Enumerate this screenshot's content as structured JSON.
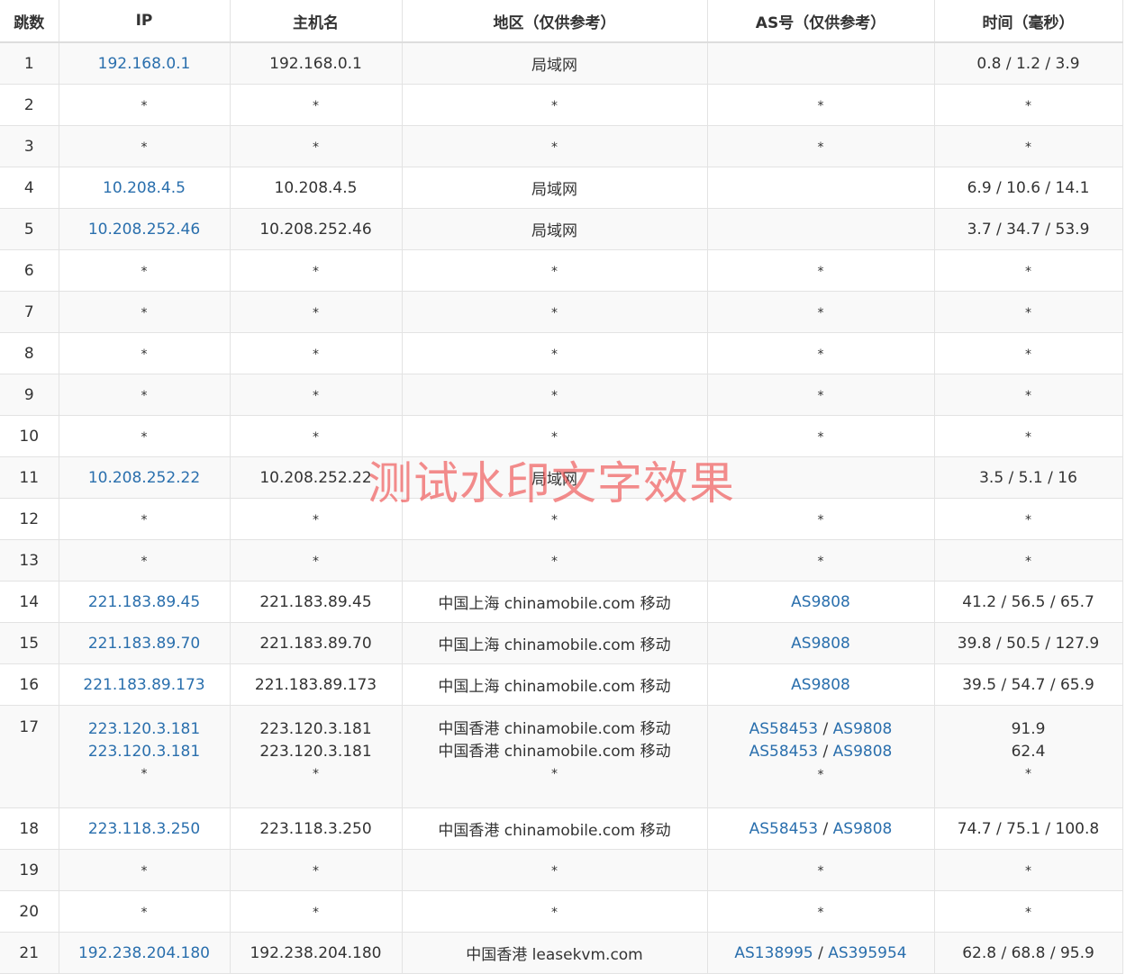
{
  "headers": [
    "跳数",
    "IP",
    "主机名",
    "地区（仅供参考）",
    "AS号（仅供参考）",
    "时间（毫秒）"
  ],
  "watermark": "测试水印文字效果",
  "rows": [
    {
      "hop": "1",
      "ip": [
        "192.168.0.1"
      ],
      "host": [
        "192.168.0.1"
      ],
      "region": [
        "局域网"
      ],
      "as": [
        []
      ],
      "time": [
        "0.8 / 1.2 / 3.9"
      ]
    },
    {
      "hop": "2",
      "ip": [
        "*"
      ],
      "host": [
        "*"
      ],
      "region": [
        "*"
      ],
      "as": [
        [
          "*"
        ]
      ],
      "time": [
        "*"
      ]
    },
    {
      "hop": "3",
      "ip": [
        "*"
      ],
      "host": [
        "*"
      ],
      "region": [
        "*"
      ],
      "as": [
        [
          "*"
        ]
      ],
      "time": [
        "*"
      ]
    },
    {
      "hop": "4",
      "ip": [
        "10.208.4.5"
      ],
      "host": [
        "10.208.4.5"
      ],
      "region": [
        "局域网"
      ],
      "as": [
        []
      ],
      "time": [
        "6.9 / 10.6 / 14.1"
      ]
    },
    {
      "hop": "5",
      "ip": [
        "10.208.252.46"
      ],
      "host": [
        "10.208.252.46"
      ],
      "region": [
        "局域网"
      ],
      "as": [
        []
      ],
      "time": [
        "3.7 / 34.7 / 53.9"
      ]
    },
    {
      "hop": "6",
      "ip": [
        "*"
      ],
      "host": [
        "*"
      ],
      "region": [
        "*"
      ],
      "as": [
        [
          "*"
        ]
      ],
      "time": [
        "*"
      ]
    },
    {
      "hop": "7",
      "ip": [
        "*"
      ],
      "host": [
        "*"
      ],
      "region": [
        "*"
      ],
      "as": [
        [
          "*"
        ]
      ],
      "time": [
        "*"
      ]
    },
    {
      "hop": "8",
      "ip": [
        "*"
      ],
      "host": [
        "*"
      ],
      "region": [
        "*"
      ],
      "as": [
        [
          "*"
        ]
      ],
      "time": [
        "*"
      ]
    },
    {
      "hop": "9",
      "ip": [
        "*"
      ],
      "host": [
        "*"
      ],
      "region": [
        "*"
      ],
      "as": [
        [
          "*"
        ]
      ],
      "time": [
        "*"
      ]
    },
    {
      "hop": "10",
      "ip": [
        "*"
      ],
      "host": [
        "*"
      ],
      "region": [
        "*"
      ],
      "as": [
        [
          "*"
        ]
      ],
      "time": [
        "*"
      ]
    },
    {
      "hop": "11",
      "ip": [
        "10.208.252.22"
      ],
      "host": [
        "10.208.252.22"
      ],
      "region": [
        "局域网"
      ],
      "as": [
        []
      ],
      "time": [
        "3.5 / 5.1 / 16"
      ]
    },
    {
      "hop": "12",
      "ip": [
        "*"
      ],
      "host": [
        "*"
      ],
      "region": [
        "*"
      ],
      "as": [
        [
          "*"
        ]
      ],
      "time": [
        "*"
      ]
    },
    {
      "hop": "13",
      "ip": [
        "*"
      ],
      "host": [
        "*"
      ],
      "region": [
        "*"
      ],
      "as": [
        [
          "*"
        ]
      ],
      "time": [
        "*"
      ]
    },
    {
      "hop": "14",
      "ip": [
        "221.183.89.45"
      ],
      "host": [
        "221.183.89.45"
      ],
      "region": [
        "中国上海 chinamobile.com 移动"
      ],
      "as": [
        [
          "AS9808"
        ]
      ],
      "time": [
        "41.2 / 56.5 / 65.7"
      ]
    },
    {
      "hop": "15",
      "ip": [
        "221.183.89.70"
      ],
      "host": [
        "221.183.89.70"
      ],
      "region": [
        "中国上海 chinamobile.com 移动"
      ],
      "as": [
        [
          "AS9808"
        ]
      ],
      "time": [
        "39.8 / 50.5 / 127.9"
      ]
    },
    {
      "hop": "16",
      "ip": [
        "221.183.89.173"
      ],
      "host": [
        "221.183.89.173"
      ],
      "region": [
        "中国上海 chinamobile.com 移动"
      ],
      "as": [
        [
          "AS9808"
        ]
      ],
      "time": [
        "39.5 / 54.7 / 65.9"
      ]
    },
    {
      "hop": "17",
      "ip": [
        "223.120.3.181",
        "223.120.3.181",
        "*"
      ],
      "host": [
        "223.120.3.181",
        "223.120.3.181",
        "*"
      ],
      "region": [
        "中国香港 chinamobile.com 移动",
        "中国香港 chinamobile.com 移动",
        "*"
      ],
      "as": [
        [
          "AS58453",
          "AS9808"
        ],
        [
          "AS58453",
          "AS9808"
        ],
        [
          "*"
        ]
      ],
      "time": [
        "91.9",
        "62.4",
        "*"
      ]
    },
    {
      "hop": "18",
      "ip": [
        "223.118.3.250"
      ],
      "host": [
        "223.118.3.250"
      ],
      "region": [
        "中国香港 chinamobile.com 移动"
      ],
      "as": [
        [
          "AS58453",
          "AS9808"
        ]
      ],
      "time": [
        "74.7 / 75.1 / 100.8"
      ]
    },
    {
      "hop": "19",
      "ip": [
        "*"
      ],
      "host": [
        "*"
      ],
      "region": [
        "*"
      ],
      "as": [
        [
          "*"
        ]
      ],
      "time": [
        "*"
      ]
    },
    {
      "hop": "20",
      "ip": [
        "*"
      ],
      "host": [
        "*"
      ],
      "region": [
        "*"
      ],
      "as": [
        [
          "*"
        ]
      ],
      "time": [
        "*"
      ]
    },
    {
      "hop": "21",
      "ip": [
        "192.238.204.180"
      ],
      "host": [
        "192.238.204.180"
      ],
      "region": [
        "中国香港 leasekvm.com"
      ],
      "as": [
        [
          "AS138995",
          "AS395954"
        ]
      ],
      "time": [
        "62.8 / 68.8 / 95.9"
      ]
    }
  ]
}
